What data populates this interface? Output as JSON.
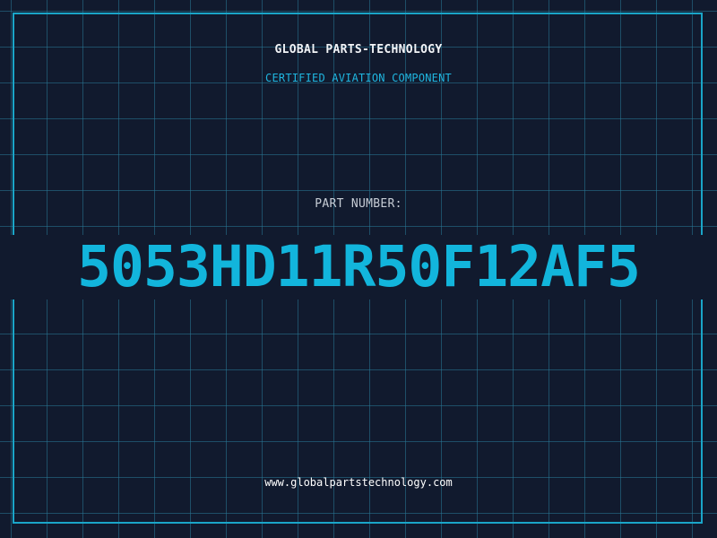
{
  "header": {
    "company": "GLOBAL PARTS-TECHNOLOGY",
    "subtitle": "CERTIFIED AVIATION COMPONENT"
  },
  "part": {
    "label": "PART NUMBER:",
    "number": "5053HD11R50F12AF5"
  },
  "footer": {
    "url": "www.globalpartstechnology.com"
  },
  "colors": {
    "background": "#111a2e",
    "grid": "#28789a",
    "accent": "#12b5dc",
    "frame": "#1aa5c8",
    "text": "#f2f4f7"
  }
}
